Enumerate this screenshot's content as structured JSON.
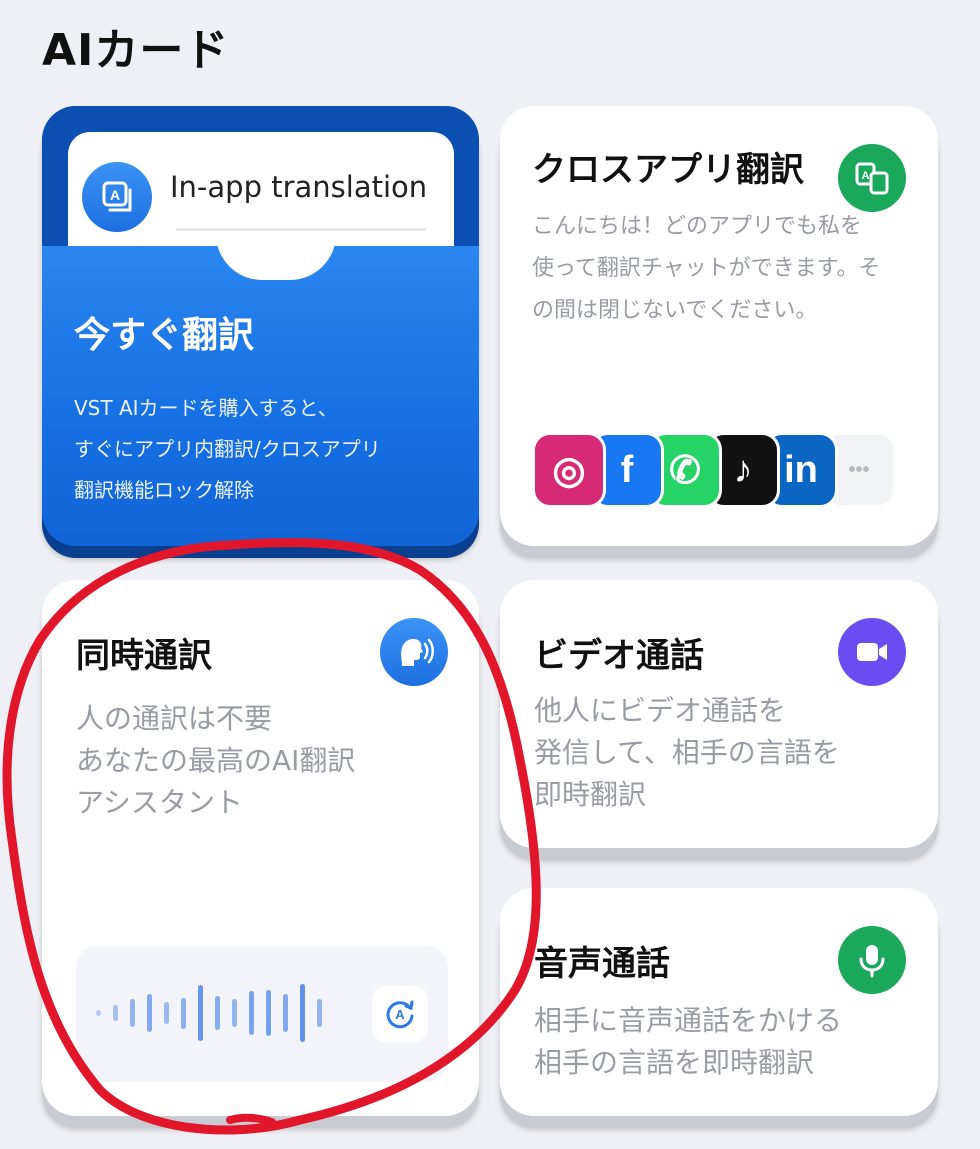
{
  "page": {
    "title": "AIカード"
  },
  "promo": {
    "inner_label": "In-app translation",
    "heading": "今すぐ翻訳",
    "desc_lines": [
      "VST AIカードを購入すると、",
      "すぐにアプリ内翻訳/クロスアプリ",
      "翻訳機能ロック解除"
    ],
    "icon": "translate-a-icon"
  },
  "cross_app": {
    "title": "クロスアプリ翻訳",
    "desc_lines": [
      "こんにちは！どのアプリでも私を",
      "使って翻訳チャットができます。そ",
      "の間は閉じないでください。"
    ],
    "icon": "translate-window-icon",
    "apps": [
      {
        "name": "instagram-icon",
        "label": "◎",
        "color": "#d62976"
      },
      {
        "name": "facebook-icon",
        "label": "f",
        "color": "#1877f2"
      },
      {
        "name": "whatsapp-icon",
        "label": "✆",
        "color": "#25d366"
      },
      {
        "name": "tiktok-icon",
        "label": "♪",
        "color": "#111111"
      },
      {
        "name": "linkedin-icon",
        "label": "in",
        "color": "#0a66c2"
      },
      {
        "name": "more-icon",
        "label": "•••",
        "color": "#f2f3f5"
      }
    ]
  },
  "simultaneous": {
    "title": "同時通訳",
    "desc_lines": [
      "人の通訳は不要",
      "あなたの最高のAI翻訳",
      "アシスタント"
    ],
    "icon": "speaking-head-icon",
    "wave_levels": [
      0.1,
      0.25,
      0.45,
      0.6,
      0.35,
      0.5,
      0.9,
      0.55,
      0.45,
      0.7,
      0.75,
      0.6,
      0.95,
      0.45
    ]
  },
  "video_call": {
    "title": "ビデオ通話",
    "desc_lines": [
      "他人にビデオ通話を",
      "発信して、相手の言語を",
      "即時翻訳"
    ],
    "icon": "video-camera-icon"
  },
  "voice_call": {
    "title": "音声通話",
    "desc_lines": [
      "相手に音声通話をかける",
      "相手の言語を即時翻訳"
    ],
    "icon": "microphone-icon"
  },
  "colors": {
    "promo_blue": "#1a6fe3",
    "green": "#1aa85a",
    "purple": "#6a4df2",
    "annotation_red": "#e2162b"
  }
}
